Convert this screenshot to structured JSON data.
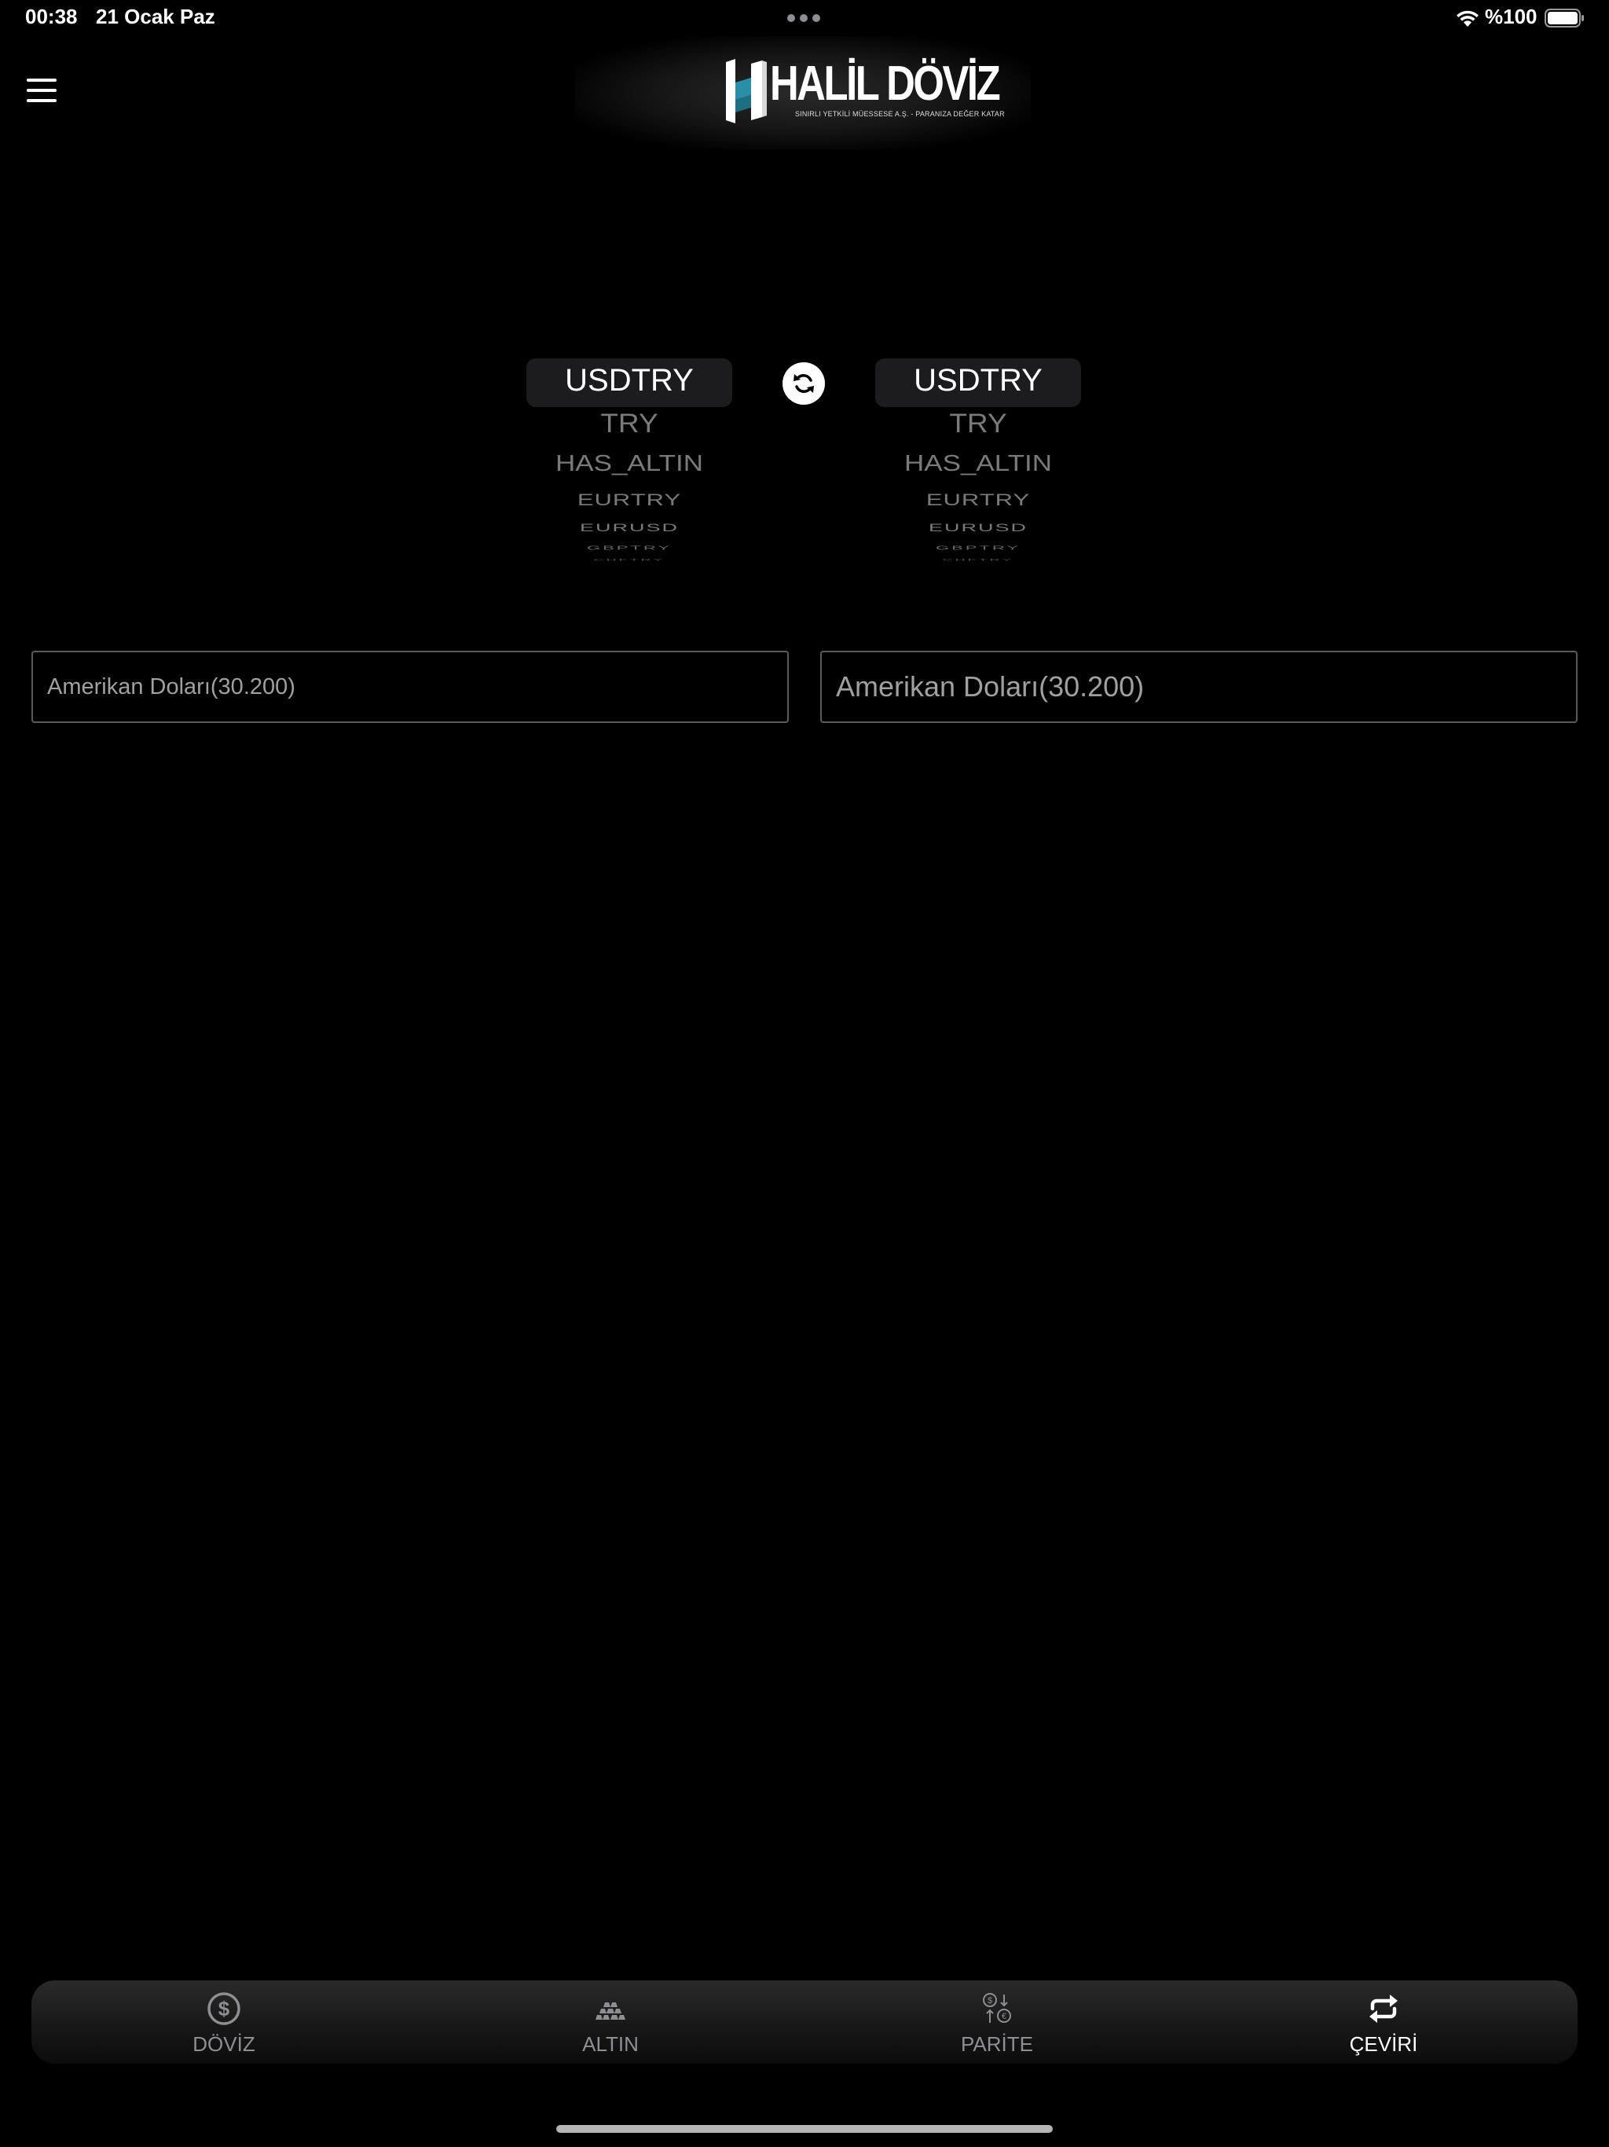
{
  "status_bar": {
    "time": "00:38",
    "date": "21 Ocak Paz",
    "battery": "%100"
  },
  "header": {
    "menu_icon": "hamburger-menu-icon",
    "logo_text": "HALİL DÖVİZ",
    "logo_tagline": "SINIRLI YETKİLİ MÜESSESE A.Ş. - PARANIZA DEĞER KATAR",
    "logo_colors": {
      "mark_primary": "#ffffff",
      "mark_accent": "#2a8ea6"
    }
  },
  "converter": {
    "from_picker": {
      "selected": "USDTRY",
      "options": [
        "USDTRY",
        "TRY",
        "HAS_ALTIN",
        "EURTRY",
        "EURUSD",
        "GBPTRY",
        "CHFTRY"
      ]
    },
    "to_picker": {
      "selected": "USDTRY",
      "options": [
        "USDTRY",
        "TRY",
        "HAS_ALTIN",
        "EURTRY",
        "EURUSD",
        "GBPTRY",
        "CHFTRY"
      ]
    },
    "swap_icon": "swap-refresh-icon",
    "from_input": {
      "value": "",
      "placeholder": "Amerikan Doları(30.200)"
    },
    "to_input": {
      "value": "",
      "placeholder": "Amerikan Doları(30.200)"
    }
  },
  "tab_bar": {
    "tabs": [
      {
        "label": "DÖVİZ",
        "icon": "dollar-circle-icon",
        "active": false
      },
      {
        "label": "ALTIN",
        "icon": "gold-bars-icon",
        "active": false
      },
      {
        "label": "PARİTE",
        "icon": "currency-exchange-icon",
        "active": false
      },
      {
        "label": "ÇEVİRİ",
        "icon": "repeat-arrows-icon",
        "active": true
      }
    ],
    "active_color": "#ffffff",
    "inactive_color": "#8e8e93"
  }
}
